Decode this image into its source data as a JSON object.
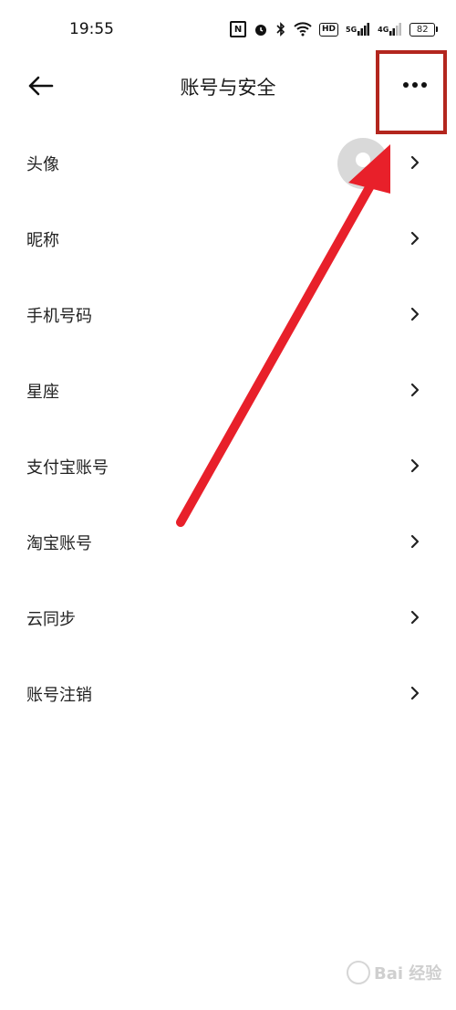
{
  "status_bar": {
    "time": "19:55",
    "icons": [
      "nfc-icon",
      "alarm-icon",
      "bluetooth-icon",
      "wifi-icon",
      "hd-icon",
      "5g-signal-icon",
      "4g-signal-icon"
    ],
    "hd_label": "HD",
    "signal_5g": "5G",
    "signal_4g": "4G",
    "battery_level": "82"
  },
  "header": {
    "title": "账号与安全",
    "back_icon": "back-arrow-icon",
    "more_icon": "more-icon"
  },
  "list": {
    "items": [
      {
        "label": "头像",
        "has_avatar": true
      },
      {
        "label": "昵称"
      },
      {
        "label": "手机号码"
      },
      {
        "label": "星座"
      },
      {
        "label": "支付宝账号"
      },
      {
        "label": "淘宝账号"
      },
      {
        "label": "云同步"
      },
      {
        "label": "账号注销"
      }
    ]
  },
  "annotation": {
    "box_color": "#b3261e",
    "arrow_color": "#e8202a"
  },
  "watermark": {
    "text": "Bai 经验"
  }
}
